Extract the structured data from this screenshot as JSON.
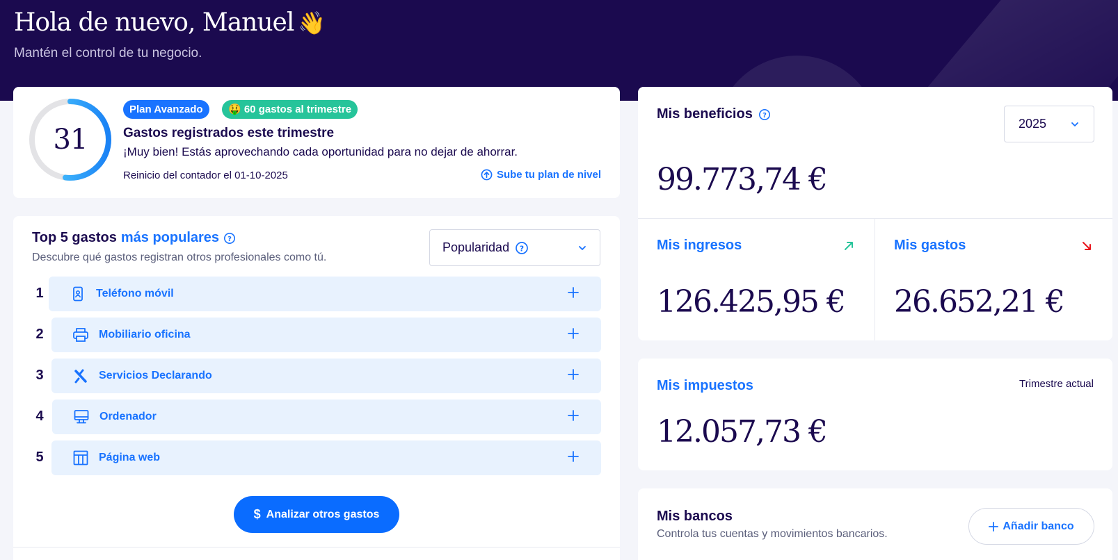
{
  "header": {
    "greeting": "Hola de nuevo, Manuel",
    "wave_emoji": "👋",
    "subtitle": "Mantén el control de tu negocio."
  },
  "counter": {
    "value": "31",
    "progress_fraction": 0.52,
    "plan_badge": "Plan Avanzado",
    "quota_badge": "🤑 60 gastos al trimestre",
    "title": "Gastos registrados este trimestre",
    "description": "¡Muy bien! Estás aprovechando cada oportunidad para no dejar de ahorrar.",
    "reset_text": "Reinicio del contador el 01-10-2025",
    "upgrade_link": "Sube tu plan de nivel"
  },
  "top5": {
    "title_prefix": "Top 5 gastos",
    "title_highlight": "más populares",
    "subtitle": "Descubre qué gastos registran otros profesionales como tú.",
    "sort_select": "Popularidad",
    "items": [
      {
        "rank": "1",
        "label": "Teléfono móvil",
        "icon": "mobile-phone-icon"
      },
      {
        "rank": "2",
        "label": "Mobiliario oficina",
        "icon": "printer-icon"
      },
      {
        "rank": "3",
        "label": "Servicios Declarando",
        "icon": "declarando-logo-icon"
      },
      {
        "rank": "4",
        "label": "Ordenador",
        "icon": "computer-icon"
      },
      {
        "rank": "5",
        "label": "Página web",
        "icon": "web-layout-icon"
      }
    ],
    "analyze_button": "Analizar otros gastos"
  },
  "benefits": {
    "title": "Mis beneficios",
    "year": "2025",
    "amount": "99.773,74 €",
    "income_title": "Mis ingresos",
    "income_amount": "126.425,95 €",
    "expenses_title": "Mis gastos",
    "expenses_amount": "26.652,21 €"
  },
  "taxes": {
    "title": "Mis impuestos",
    "period": "Trimestre actual",
    "amount": "12.057,73 €"
  },
  "banks": {
    "title": "Mis bancos",
    "subtitle": "Controla tus cuentas y movimientos bancarios.",
    "add_button": "Añadir banco"
  },
  "colors": {
    "hero_bg": "#1b0a4f",
    "accent_blue": "#1973ff",
    "green_badge": "#26c49a",
    "income_arrow": "#26c49a",
    "expense_arrow": "#e8141c",
    "row_bg": "#e8f2fe"
  }
}
